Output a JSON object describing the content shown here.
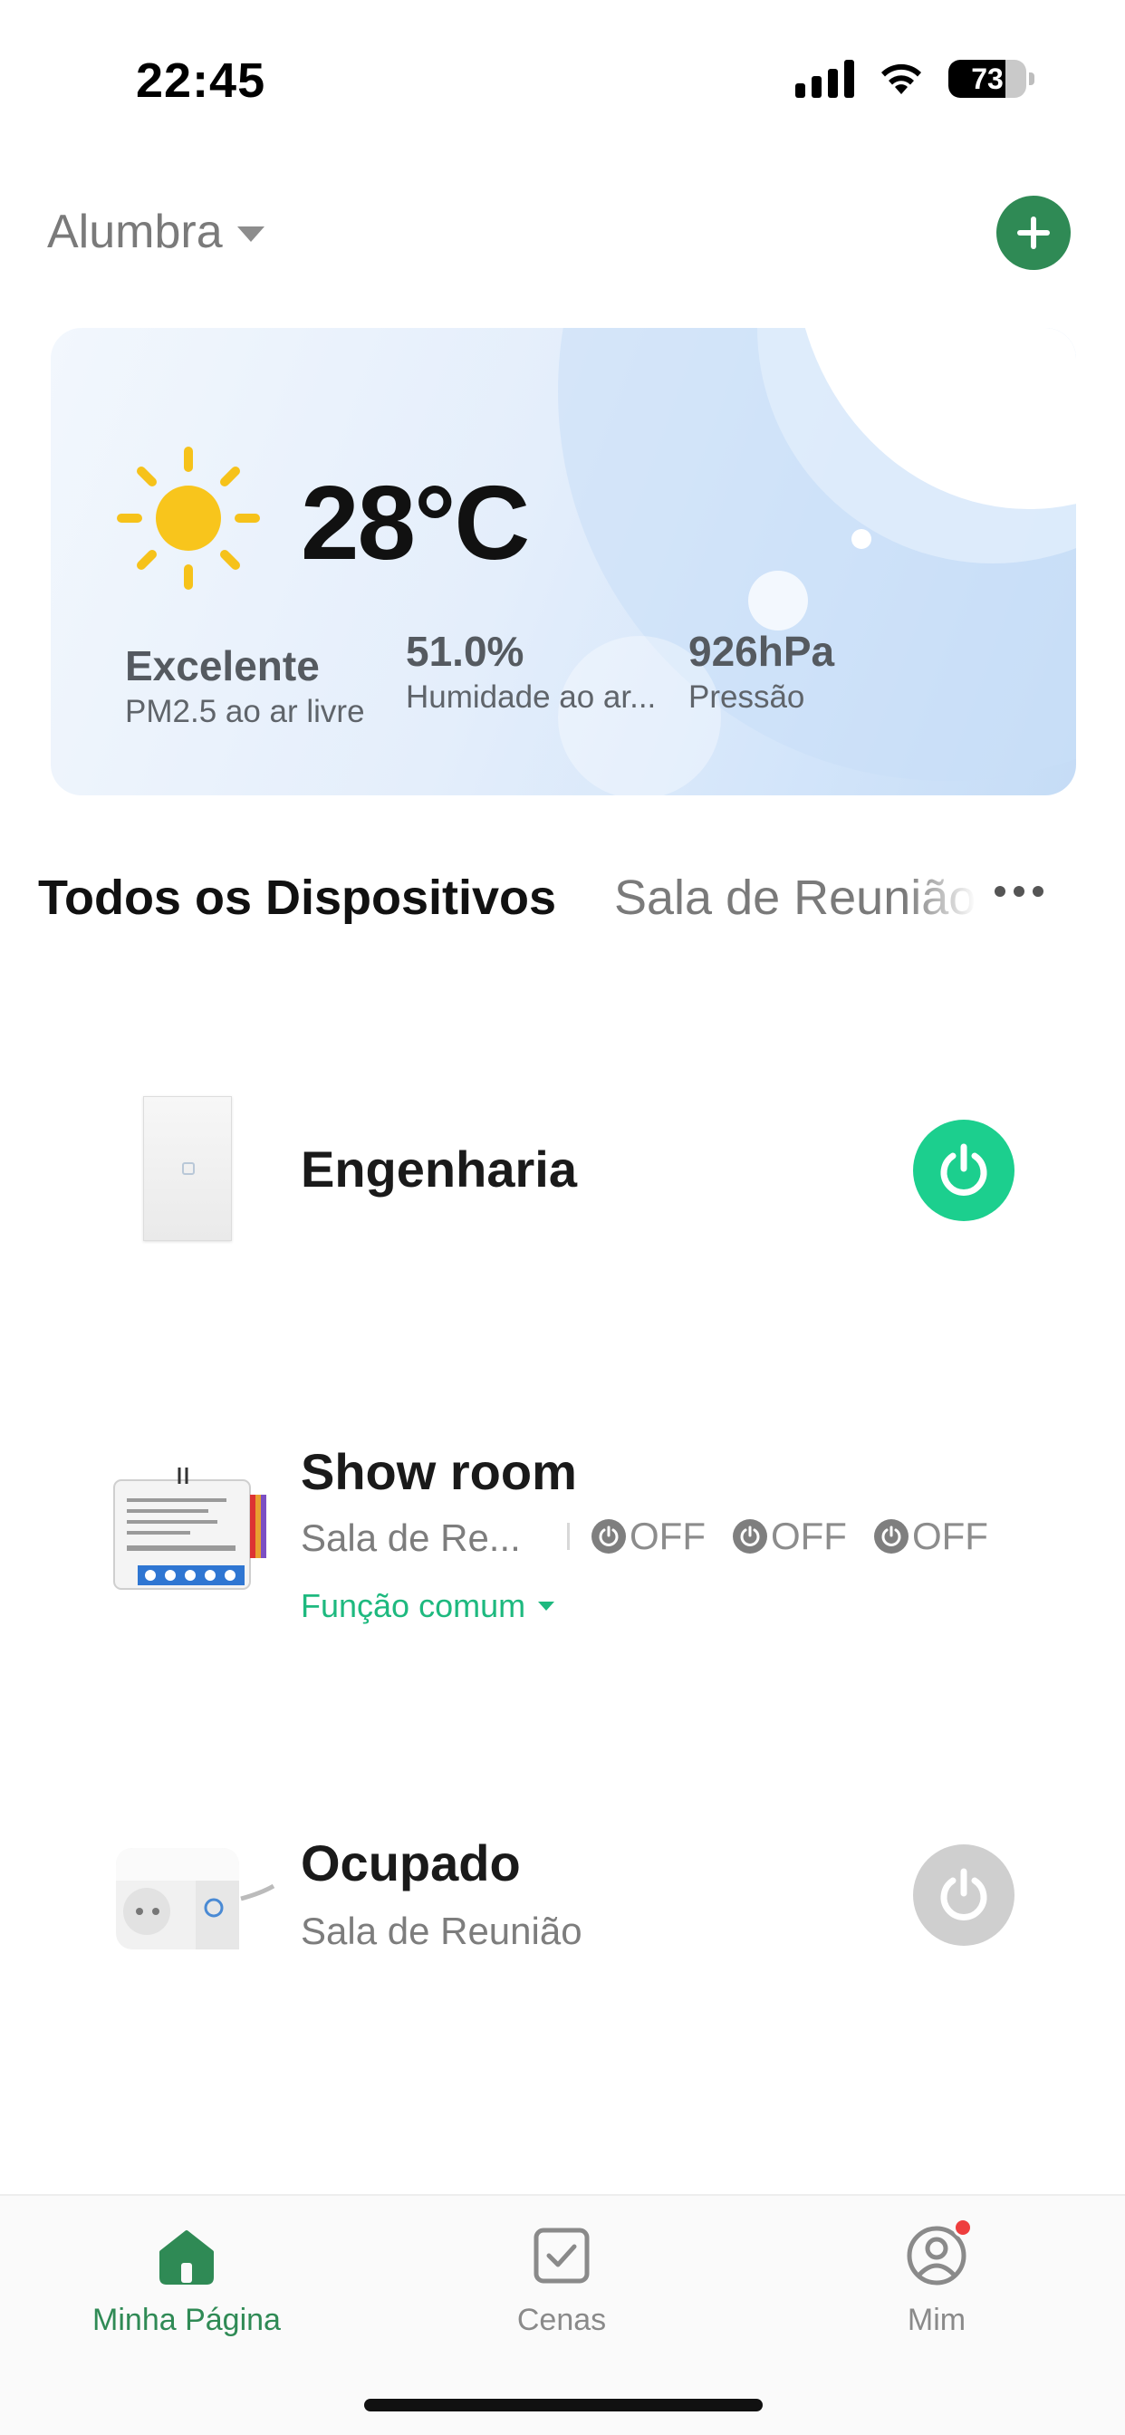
{
  "status_bar": {
    "time": "22:45",
    "battery_level": "73",
    "icons": [
      "signal-icon",
      "wifi-icon",
      "battery-icon"
    ]
  },
  "header": {
    "home_name": "Alumbra",
    "add_icon": "plus-icon"
  },
  "weather": {
    "temperature": "28°C",
    "condition_icon": "sun-icon",
    "air_quality_value": "Excelente",
    "air_quality_label": "PM2.5 ao ar livre",
    "humidity_value": "51.0%",
    "humidity_label": "Humidade ao ar...",
    "pressure_value": "926hPa",
    "pressure_label": "Pressão"
  },
  "tabs": {
    "active": "Todos os Dispositivos",
    "second": "Sala de Reunião",
    "more_icon": "more-dots-icon"
  },
  "devices": [
    {
      "name": "Engenharia",
      "room": "",
      "power_state": "on",
      "image": "wall-switch-image"
    },
    {
      "name": "Show room",
      "room": "Sala de Re...",
      "channels": [
        "OFF",
        "OFF",
        "OFF"
      ],
      "common_function": "Função comum",
      "image": "switch-module-image"
    },
    {
      "name": "Ocupado",
      "room": "Sala de Reunião",
      "power_state": "off",
      "image": "smart-plug-image"
    }
  ],
  "bottom_nav": {
    "items": [
      {
        "label": "Minha Página",
        "icon": "home-icon",
        "active": true
      },
      {
        "label": "Cenas",
        "icon": "checkbox-icon",
        "active": false
      },
      {
        "label": "Mim",
        "icon": "profile-icon",
        "active": false,
        "notification": true
      }
    ]
  },
  "colors": {
    "accent_green": "#2f8a55",
    "power_on": "#1ccf8e",
    "power_off": "#cfcfcf",
    "function_green": "#1eb97f",
    "notification_red": "#ee3e3e"
  }
}
